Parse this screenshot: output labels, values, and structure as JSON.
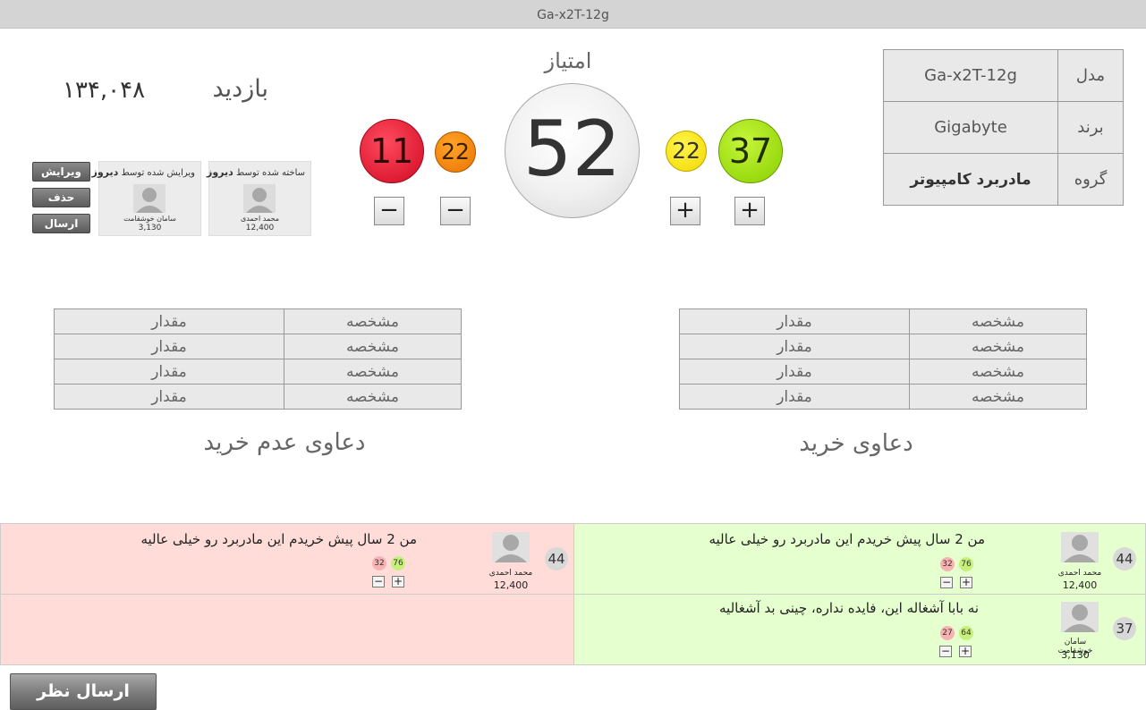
{
  "window": {
    "title": "Ga-x2T-12g"
  },
  "product": {
    "rows": [
      {
        "label": "مدل",
        "value": "Ga-x2T-12g"
      },
      {
        "label": "برند",
        "value": "Gigabyte"
      },
      {
        "label": "گروه",
        "value": "مادربرد کامپیوتر"
      }
    ]
  },
  "score": {
    "label": "امتیاز",
    "total": "52",
    "up_strong": "37",
    "up_weak": "22",
    "down_weak": "22",
    "down_strong": "11",
    "plus": "+",
    "minus": "−",
    "colors": {
      "up_strong": "#88d000",
      "up_weak": "#f3d900",
      "down_weak": "#ea7400",
      "down_strong": "#d10a22"
    }
  },
  "visits": {
    "label": "بازدید",
    "value": "۱۳۴,۰۴۸"
  },
  "actions": {
    "edit": "ویرایش",
    "delete": "حذف",
    "send": "ارسال نظر"
  },
  "cards": {
    "created": {
      "caption": "ساخته شده توسط",
      "when": "دیروز",
      "name": "محمد احمدی",
      "points": "12,400"
    },
    "edited": {
      "caption": "ویرایش شده توسط",
      "when": "دیروز",
      "name": "سامان خوشقامت",
      "points": "3,130"
    }
  },
  "claims_buy": {
    "title": "دعاوی خرید",
    "rows": [
      {
        "key": "مشخصه",
        "val": "مقدار"
      },
      {
        "key": "مشخصه",
        "val": "مقدار"
      },
      {
        "key": "مشخصه",
        "val": "مقدار"
      },
      {
        "key": "مشخصه",
        "val": "مقدار"
      }
    ]
  },
  "claims_nobuy": {
    "title": "دعاوی عدم خرید",
    "rows": [
      {
        "key": "مشخصه",
        "val": "مقدار"
      },
      {
        "key": "مشخصه",
        "val": "مقدار"
      },
      {
        "key": "مشخصه",
        "val": "مقدار"
      },
      {
        "key": "مشخصه",
        "val": "مقدار"
      }
    ]
  },
  "comments": {
    "positive": [
      {
        "score": "44",
        "name": "محمد احمدی",
        "points": "12,400",
        "text": "من 2 سال پیش خریدم این مادربرد رو خیلی عالیه",
        "up": "76",
        "down": "32"
      },
      {
        "score": "37",
        "name": "سامان خوشقامت",
        "points": "3,130",
        "text": "نه بابا آشغاله این، فایده نداره، چینی بد آشغالیه",
        "up": "64",
        "down": "27"
      }
    ],
    "negative": [
      {
        "score": "44",
        "name": "محمد احمدی",
        "points": "12,400",
        "text": "من 2 سال پیش خریدم این مادربرد رو خیلی عالیه",
        "up": "76",
        "down": "32"
      }
    ]
  },
  "send_button": "ارسال نظر"
}
